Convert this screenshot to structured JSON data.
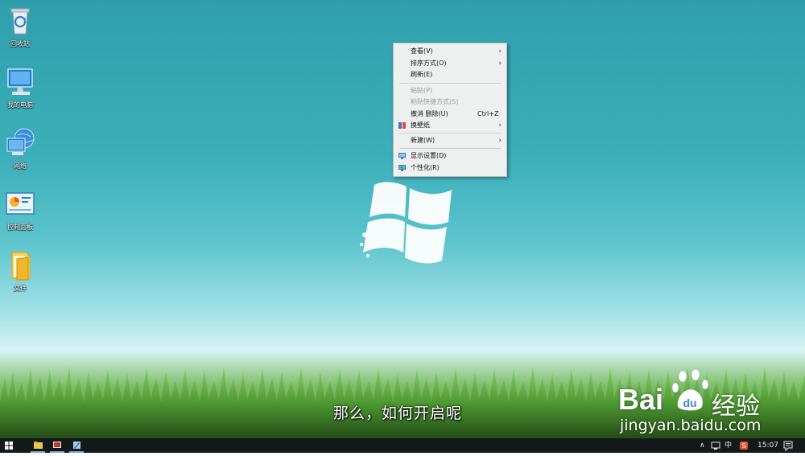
{
  "desktop": {
    "icons": [
      {
        "label": "回收站",
        "icon": "recycle-bin-icon"
      },
      {
        "label": "我的电脑",
        "icon": "computer-icon"
      },
      {
        "label": "网络",
        "icon": "network-icon"
      },
      {
        "label": "控制面板",
        "icon": "control-panel-icon"
      },
      {
        "label": "文件",
        "icon": "folder-icon"
      }
    ]
  },
  "context_menu": {
    "items": [
      {
        "label": "查看(V)",
        "submenu": true
      },
      {
        "label": "排序方式(O)",
        "submenu": true
      },
      {
        "label": "刷新(E)"
      },
      {
        "label": "粘贴(P)",
        "disabled": true
      },
      {
        "label": "粘贴快捷方式(S)",
        "disabled": true
      },
      {
        "label": "撤消 删除(U)",
        "shortcut": "Ctrl+Z"
      },
      {
        "label": "换壁纸",
        "submenu": true,
        "icon": "wallpaper-icon"
      },
      {
        "label": "新建(W)",
        "submenu": true
      },
      {
        "label": "显示设置(D)",
        "icon": "display-settings-icon"
      },
      {
        "label": "个性化(R)",
        "icon": "personalize-icon"
      }
    ]
  },
  "subtitle": "那么，如何开启呢",
  "watermark": {
    "brand": "Bai",
    "brand_tail": "经验",
    "url": "jingyan.baidu.com"
  },
  "taskbar": {
    "ime": "中",
    "clock": "15:07"
  },
  "colors": {
    "taskbar": "#141a1c",
    "menu_bg": "#eef0f0",
    "desktop_top": "#2f9fad"
  }
}
